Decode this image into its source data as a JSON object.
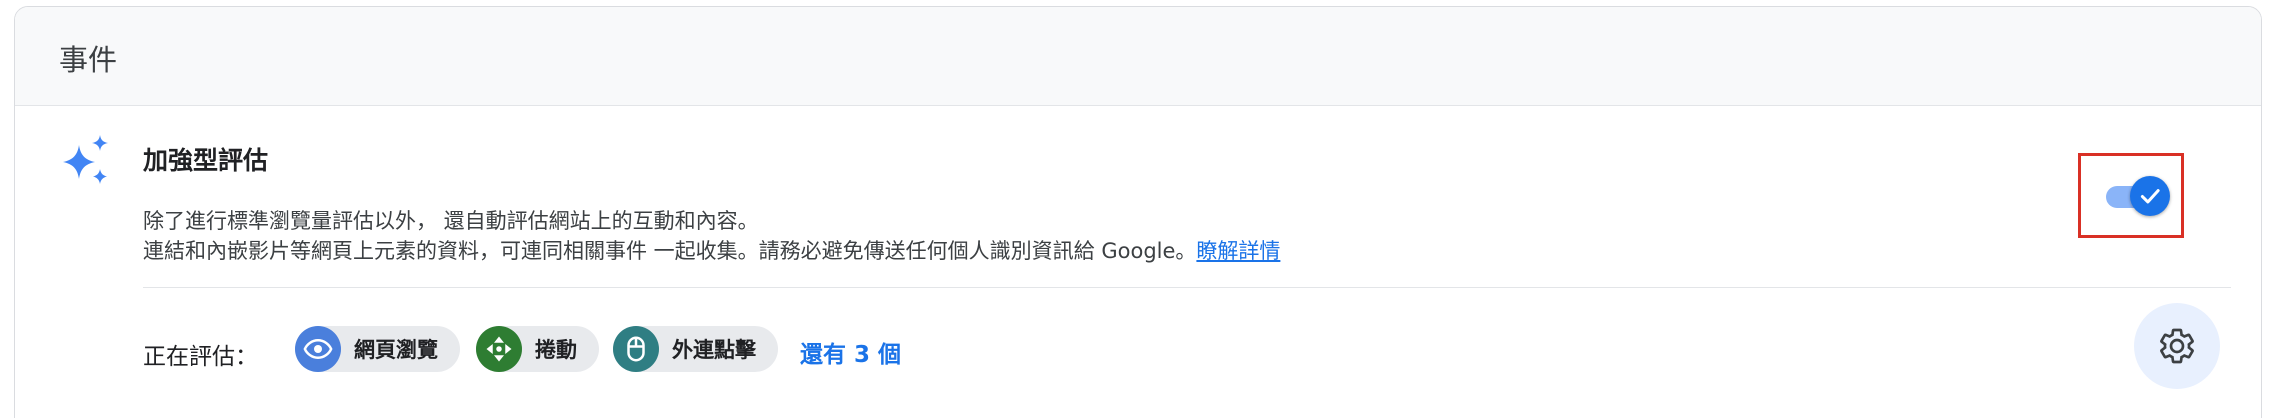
{
  "card": {
    "title": "事件"
  },
  "enhanced": {
    "icon": "sparkle-icon",
    "title": "加強型評估",
    "desc_line1": "除了進行標準瀏覽量評估以外， 還自動評估網站上的互動和內容。",
    "desc_line2": "連結和內嵌影片等網頁上元素的資料，可連同相關事件 一起收集。請務必避免傳送任何個人識別資訊給 Google。",
    "learn_more": "瞭解詳情",
    "toggle_on": true
  },
  "evaluating": {
    "label": "正在評估：",
    "chips": [
      {
        "label": "網頁瀏覽",
        "icon": "eye-icon",
        "color": "#4a7fdc"
      },
      {
        "label": "捲動",
        "icon": "scroll-icon",
        "color": "#2e7d32"
      },
      {
        "label": "外連點擊",
        "icon": "mouse-icon",
        "color": "#2f7e83"
      }
    ],
    "more": "還有 3 個"
  },
  "colors": {
    "accent": "#1a73e8",
    "highlight_border": "#d93025"
  },
  "settings_icon": "gear-icon"
}
